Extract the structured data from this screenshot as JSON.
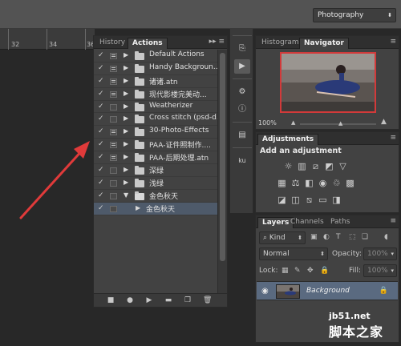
{
  "workspace": {
    "selected": "Photography"
  },
  "ruler": {
    "ticks": [
      "32",
      "34",
      "36"
    ]
  },
  "actions_panel": {
    "tabs": [
      "History",
      "Actions"
    ],
    "active_tab": "Actions",
    "menu_icon": "panel-menu-icon",
    "items": [
      {
        "label": "Default Actions",
        "checked": true,
        "dialog": true,
        "expanded": false,
        "level": 0
      },
      {
        "label": "Handy Backgroun...",
        "checked": true,
        "dialog": true,
        "expanded": false,
        "level": 0
      },
      {
        "label": "诸诸.atn",
        "checked": true,
        "dialog": true,
        "expanded": false,
        "level": 0
      },
      {
        "label": "现代影楼完美动...",
        "checked": true,
        "dialog": true,
        "expanded": false,
        "level": 0
      },
      {
        "label": "Weatherizer",
        "checked": true,
        "dialog": false,
        "expanded": false,
        "level": 0
      },
      {
        "label": "Cross stitch (psd-d...",
        "checked": true,
        "dialog": false,
        "expanded": false,
        "level": 0
      },
      {
        "label": "30-Photo-Effects",
        "checked": true,
        "dialog": true,
        "expanded": false,
        "level": 0
      },
      {
        "label": "PAA-证件照制作....",
        "checked": true,
        "dialog": true,
        "expanded": false,
        "level": 0
      },
      {
        "label": "PAA-后期处理.atn",
        "checked": true,
        "dialog": true,
        "expanded": false,
        "level": 0
      },
      {
        "label": "深绿",
        "checked": true,
        "dialog": false,
        "expanded": false,
        "level": 0
      },
      {
        "label": "浅绿",
        "checked": true,
        "dialog": false,
        "expanded": false,
        "level": 0
      },
      {
        "label": "金色秋天",
        "checked": true,
        "dialog": false,
        "expanded": true,
        "level": 0
      },
      {
        "label": "金色秋天",
        "checked": true,
        "dialog": false,
        "expanded": false,
        "level": 1
      }
    ],
    "footer_icons": [
      "stop-icon",
      "record-icon",
      "play-icon",
      "new-set-icon",
      "new-action-icon",
      "delete-icon"
    ]
  },
  "navigator_panel": {
    "tabs": [
      "Histogram",
      "Navigator"
    ],
    "active_tab": "Navigator",
    "zoom": "100%"
  },
  "adjustments_panel": {
    "tab": "Adjustments",
    "title": "Add an adjustment"
  },
  "layers_panel": {
    "tabs": [
      "Layers",
      "Channels",
      "Paths"
    ],
    "active_tab": "Layers",
    "filter_kind": "Kind",
    "blend_mode": "Normal",
    "opacity_label": "Opacity:",
    "opacity_value": "100%",
    "lock_label": "Lock:",
    "fill_label": "Fill:",
    "fill_value": "100%",
    "layers": [
      {
        "name": "Background",
        "visible": true,
        "locked": true
      }
    ]
  },
  "watermark": {
    "domain": "jb51.net",
    "name": "脚本之家"
  },
  "colors": {
    "annotation_arrow": "#e03a3a",
    "selection": "#5a6a80",
    "panel_bg": "#424242"
  }
}
